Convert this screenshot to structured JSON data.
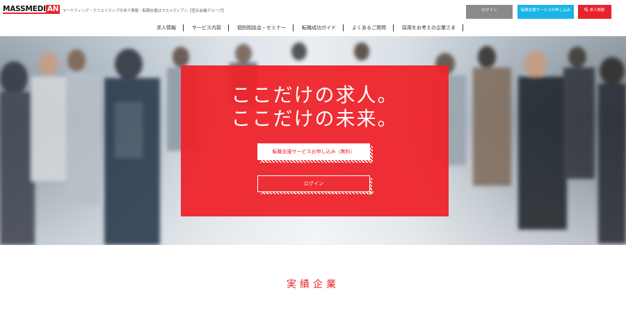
{
  "header": {
    "logo_part1": "MASSMEDI",
    "logo_part2": "AN",
    "tagline": "マーケティング・クリエイティブの求人情報・転職支援はマスメディアン【宣伝会議グループ】",
    "login_button": "ログイン",
    "service_button": "転職支援サービスの申し込み",
    "search_button": "求人検索"
  },
  "nav": {
    "items": [
      {
        "label": "求人情報"
      },
      {
        "label": "サービス内容"
      },
      {
        "label": "個別相談会・セミナー"
      },
      {
        "label": "転職成功ガイド"
      },
      {
        "label": "よくあるご質問"
      },
      {
        "label": "採用をお考えの企業さま"
      }
    ]
  },
  "hero": {
    "line1": "ここだけの求人。",
    "line2": "ここだけの未来。",
    "apply_button": "転職支援サービスお申し込み（無料）",
    "login_button": "ログイン"
  },
  "section": {
    "title": "実績企業"
  },
  "colors": {
    "brand_red": "#e8232b",
    "accent_blue": "#19b4e8",
    "login_gray": "#8a8a8a"
  },
  "icons": {
    "search": "search-icon"
  }
}
